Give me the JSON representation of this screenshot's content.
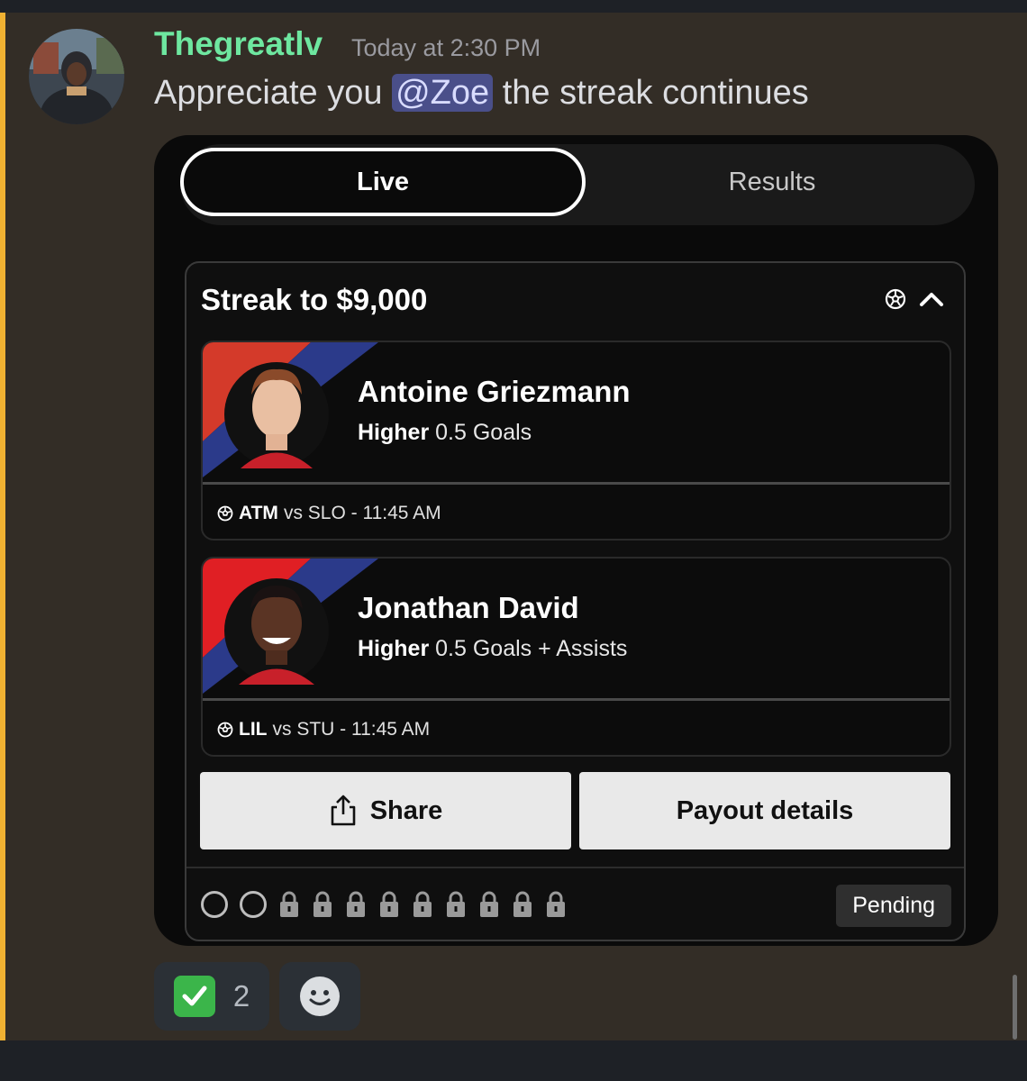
{
  "message": {
    "username": "Thegreatlv",
    "timestamp": "Today at 2:30 PM",
    "text_before": "Appreciate you",
    "mention": "@Zoe",
    "text_after": "the streak continues",
    "username_color": "#6ee7a0"
  },
  "embed": {
    "tabs": [
      {
        "label": "Live",
        "active": true
      },
      {
        "label": "Results",
        "active": false
      }
    ],
    "card": {
      "title": "Streak to $9,000",
      "icons": [
        "soccer-ball-icon",
        "chevron-up-icon"
      ],
      "picks": [
        {
          "player": "Antoine Griezmann",
          "direction": "Higher",
          "line": "0.5 Goals",
          "team": "ATM",
          "vs": "vs SLO - 11:45 AM"
        },
        {
          "player": "Jonathan David",
          "direction": "Higher",
          "line": "0.5 Goals + Assists",
          "team": "LIL",
          "vs": "vs STU - 11:45 AM"
        }
      ],
      "buttons": {
        "share": "Share",
        "payout": "Payout details"
      },
      "progress": {
        "open_slots": 2,
        "locked_slots": 9
      },
      "status": "Pending"
    }
  },
  "reactions": [
    {
      "emoji": "white-check-mark-icon",
      "count": "2"
    },
    {
      "emoji": "add-reaction-icon"
    }
  ]
}
